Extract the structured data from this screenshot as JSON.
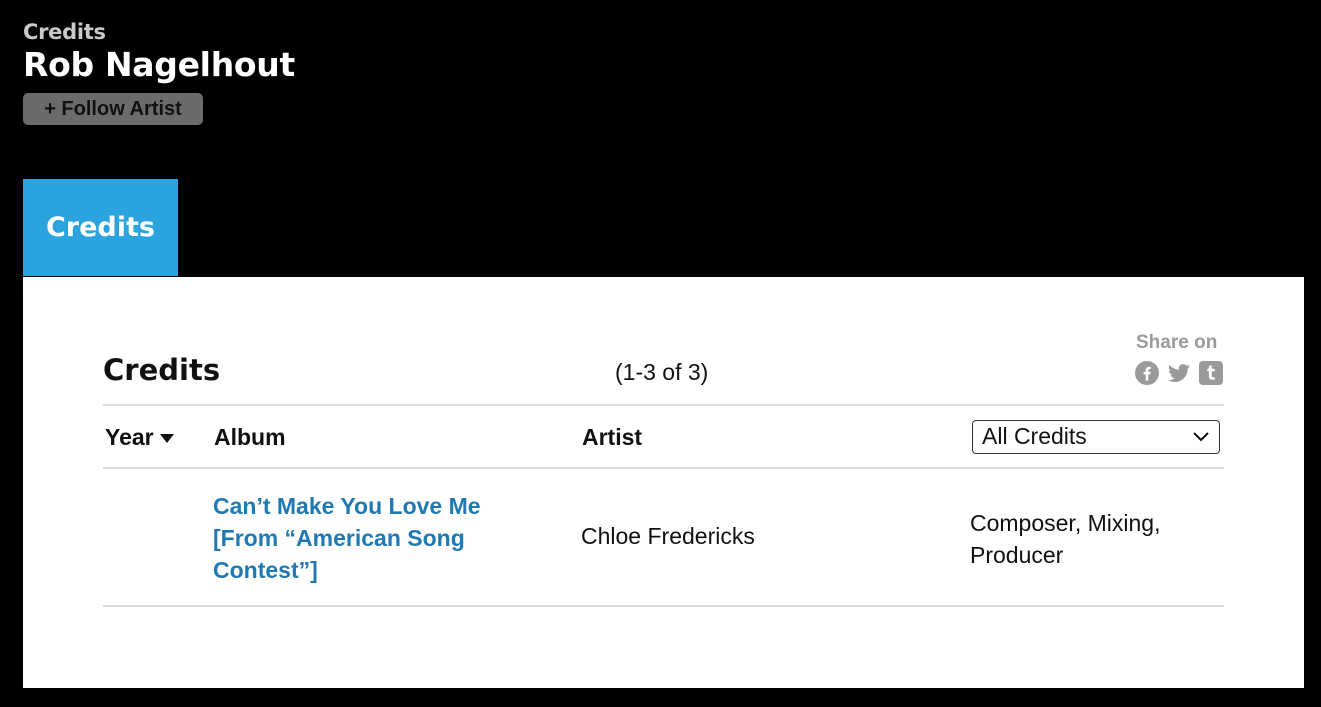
{
  "header": {
    "kicker": "Credits",
    "artist_name": "Rob Nagelhout",
    "follow_label": "+ Follow Artist"
  },
  "tabs": [
    {
      "label": "Credits",
      "active": true
    }
  ],
  "panel": {
    "title": "Credits",
    "count_text": "(1-3 of 3)",
    "share_label": "Share on",
    "share_icons": [
      "facebook-icon",
      "twitter-icon",
      "tumblr-icon"
    ],
    "columns": {
      "year": "Year",
      "album": "Album",
      "artist": "Artist"
    },
    "filter": {
      "selected": "All Credits"
    },
    "rows": [
      {
        "year": "",
        "album": "Can’t Make You Love Me [From “American Song Contest”]",
        "artist": "Chloe Fredericks",
        "roles": "Composer, Mixing, Producer"
      }
    ]
  },
  "colors": {
    "background": "#000000",
    "tab_active": "#2aa3de",
    "link": "#1f7ab3",
    "follow_button": "#6b6b6b",
    "share_gray": "#9a9a9a"
  }
}
